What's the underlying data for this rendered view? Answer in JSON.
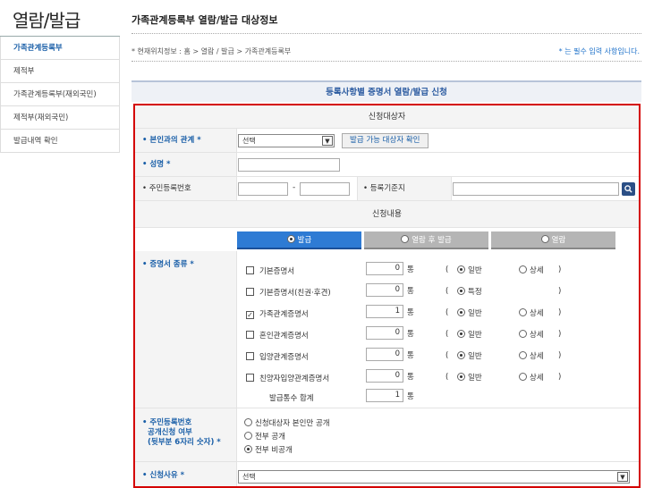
{
  "sidebar": {
    "title": "열람/발급",
    "items": [
      {
        "label": "가족관계등록부"
      },
      {
        "label": "제적부"
      },
      {
        "label": "가족관계등록부(재외국민)"
      },
      {
        "label": "제적부(재외국민)"
      },
      {
        "label": "발급내역 확인"
      }
    ]
  },
  "header": {
    "title": "가족관계등록부 열람/발급 대상정보",
    "location": "* 현재위치정보 : 홈 > 열람 / 발급 > 가족관계등록부",
    "required_note": "* 는 필수 입력 사항입니다."
  },
  "form": {
    "title": "등록사항별 증명서 열람/발급 신청",
    "section_applicant": "신청대상자",
    "relation_label": "• 본인과의 관계 *",
    "relation_value": "선택",
    "check_button": "발급 가능 대상자 확인",
    "name_label": "• 성명 *",
    "rrn_label": "• 주민등록번호",
    "rrn_dash": "-",
    "reg_base_label": "• 등록기준지",
    "section_content": "신청내용",
    "tabs": [
      {
        "label": "발급"
      },
      {
        "label": "열람 후 발급"
      },
      {
        "label": "열람"
      }
    ],
    "cert_type_label": "• 증명서 종류 *",
    "certs": [
      {
        "name": "기본증명서",
        "qty": "0",
        "checked": false,
        "opt1": "일반",
        "opt2": "상세"
      },
      {
        "name": "기본증명서(친권·후견)",
        "qty": "0",
        "checked": false,
        "opt1": "특정",
        "opt2": ""
      },
      {
        "name": "가족관계증명서",
        "qty": "1",
        "checked": true,
        "opt1": "일반",
        "opt2": "상세"
      },
      {
        "name": "혼인관계증명서",
        "qty": "0",
        "checked": false,
        "opt1": "일반",
        "opt2": "상세"
      },
      {
        "name": "입양관계증명서",
        "qty": "0",
        "checked": false,
        "opt1": "일반",
        "opt2": "상세"
      },
      {
        "name": "친양자입양관계증명서",
        "qty": "0",
        "checked": false,
        "opt1": "일반",
        "opt2": "상세"
      }
    ],
    "unit": "통",
    "paren_open": "(",
    "paren_close": ")",
    "total_label": "발급통수 합계",
    "total_qty": "1",
    "disclosure_label_1": "• 주민등록번호",
    "disclosure_label_2": "공개신청 여부",
    "disclosure_label_3": "(뒷부분 6자리 숫자) *",
    "disclosure_options": [
      {
        "label": "신청대상자 본인만 공개",
        "selected": false
      },
      {
        "label": "전부 공개",
        "selected": false
      },
      {
        "label": "전부 비공개",
        "selected": true
      }
    ],
    "reason_label": "• 신청사유 *",
    "reason_value": "선택"
  },
  "colors": {
    "accent": "#1a5fa8",
    "highlight_border": "#d40000",
    "tab_active": "#2e7bd4"
  },
  "icons": {
    "search_button": "magnifier-icon",
    "dropdown": "chevron-down-icon"
  }
}
